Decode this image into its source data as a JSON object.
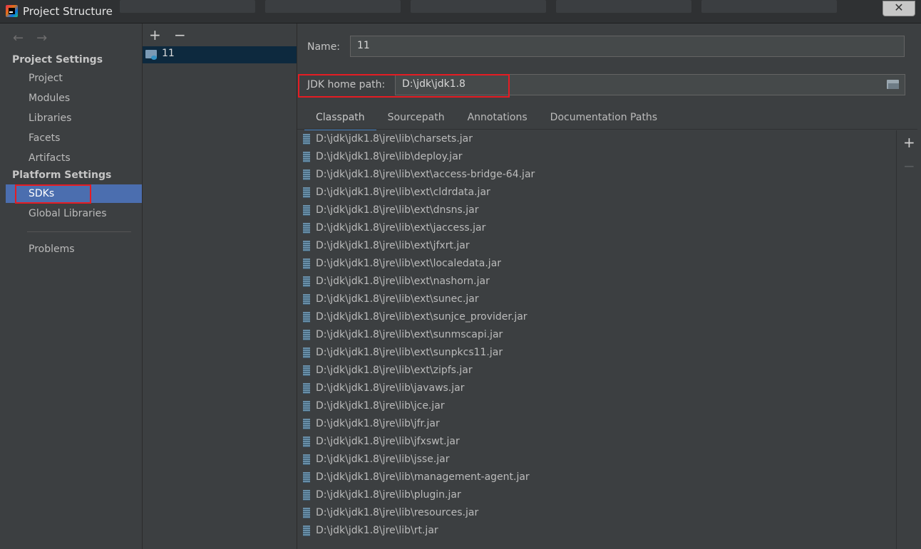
{
  "window": {
    "title": "Project Structure",
    "close_icon": "close-icon"
  },
  "sidebar": {
    "project_settings_header": "Project Settings",
    "project_items": [
      "Project",
      "Modules",
      "Libraries",
      "Facets",
      "Artifacts"
    ],
    "platform_settings_header": "Platform Settings",
    "platform_items": [
      "SDKs",
      "Global Libraries"
    ],
    "other_items": [
      "Problems"
    ],
    "selected": "SDKs"
  },
  "sdk_list": {
    "add_label": "+",
    "remove_label": "−",
    "items": [
      {
        "label": "11",
        "icon": "jdk-folder-icon"
      }
    ]
  },
  "detail": {
    "name_label": "Name:",
    "name_value": "11",
    "jdk_home_label": "JDK home path:",
    "jdk_home_value": "D:\\jdk\\jdk1.8",
    "tabs": [
      "Classpath",
      "Sourcepath",
      "Annotations",
      "Documentation Paths"
    ],
    "active_tab": "Classpath",
    "add_label": "+",
    "remove_label": "−",
    "classpath": [
      "D:\\jdk\\jdk1.8\\jre\\lib\\charsets.jar",
      "D:\\jdk\\jdk1.8\\jre\\lib\\deploy.jar",
      "D:\\jdk\\jdk1.8\\jre\\lib\\ext\\access-bridge-64.jar",
      "D:\\jdk\\jdk1.8\\jre\\lib\\ext\\cldrdata.jar",
      "D:\\jdk\\jdk1.8\\jre\\lib\\ext\\dnsns.jar",
      "D:\\jdk\\jdk1.8\\jre\\lib\\ext\\jaccess.jar",
      "D:\\jdk\\jdk1.8\\jre\\lib\\ext\\jfxrt.jar",
      "D:\\jdk\\jdk1.8\\jre\\lib\\ext\\localedata.jar",
      "D:\\jdk\\jdk1.8\\jre\\lib\\ext\\nashorn.jar",
      "D:\\jdk\\jdk1.8\\jre\\lib\\ext\\sunec.jar",
      "D:\\jdk\\jdk1.8\\jre\\lib\\ext\\sunjce_provider.jar",
      "D:\\jdk\\jdk1.8\\jre\\lib\\ext\\sunmscapi.jar",
      "D:\\jdk\\jdk1.8\\jre\\lib\\ext\\sunpkcs11.jar",
      "D:\\jdk\\jdk1.8\\jre\\lib\\ext\\zipfs.jar",
      "D:\\jdk\\jdk1.8\\jre\\lib\\javaws.jar",
      "D:\\jdk\\jdk1.8\\jre\\lib\\jce.jar",
      "D:\\jdk\\jdk1.8\\jre\\lib\\jfr.jar",
      "D:\\jdk\\jdk1.8\\jre\\lib\\jfxswt.jar",
      "D:\\jdk\\jdk1.8\\jre\\lib\\jsse.jar",
      "D:\\jdk\\jdk1.8\\jre\\lib\\management-agent.jar",
      "D:\\jdk\\jdk1.8\\jre\\lib\\plugin.jar",
      "D:\\jdk\\jdk1.8\\jre\\lib\\resources.jar",
      "D:\\jdk\\jdk1.8\\jre\\lib\\rt.jar"
    ]
  },
  "colors": {
    "selection": "#4b6eaf",
    "highlight_box": "#e51c23",
    "background": "#3c3f41"
  }
}
